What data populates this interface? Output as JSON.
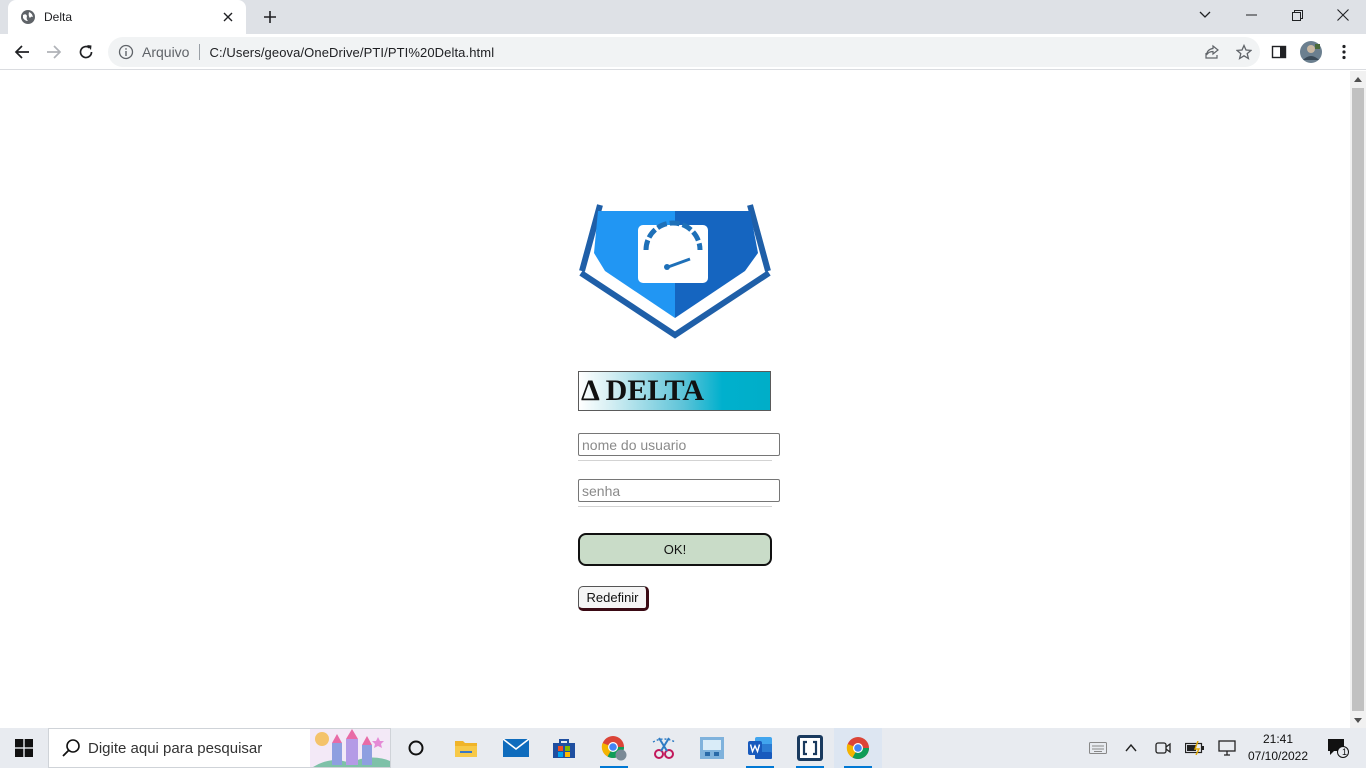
{
  "browser": {
    "tab_title": "Delta",
    "security_chip": "Arquivo",
    "url": "C:/Users/geova/OneDrive/PTI/PTI%20Delta.html"
  },
  "page": {
    "banner_text": "Δ DELTA",
    "username_placeholder": "nome do usuario",
    "password_placeholder": "senha",
    "ok_label": "OK!",
    "reset_label": "Redefinir"
  },
  "taskbar": {
    "search_placeholder": "Digite aqui para pesquisar",
    "time": "21:41",
    "date": "07/10/2022",
    "notification_count": "1"
  },
  "colors": {
    "logo_light_blue": "#2196f3",
    "logo_dark_blue": "#1565c0",
    "ok_button": "#c9dcc8",
    "banner_cyan": "#00aec8"
  }
}
